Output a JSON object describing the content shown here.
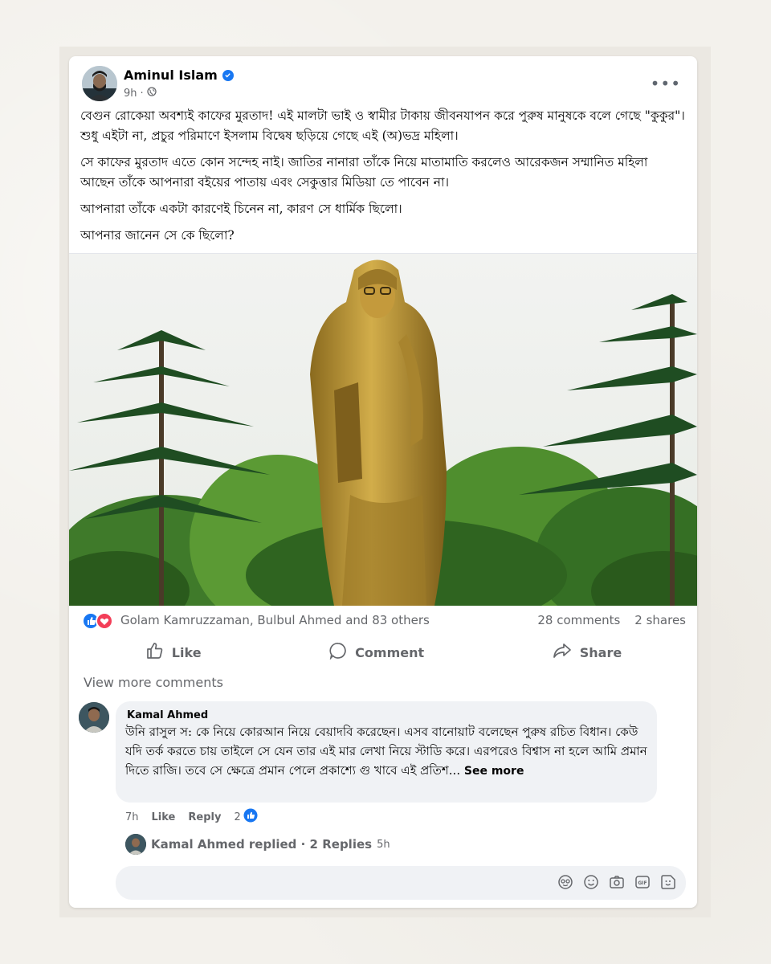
{
  "post": {
    "author": "Aminul Islam",
    "time": "9h",
    "privacy_icon": "globe-icon",
    "verified_icon": "verified-badge-icon",
    "paragraphs": [
      "বেগুন রোকেয়া অবশ্যই কাফের মুরতাদ! এই মালটা ভাই ও স্বামীর টাকায় জীবনযাপন করে পুরুষ মানুষকে বলে গেছে \"কুকুর\"। শুধু এইটা না, প্রচুর পরিমাণে ইসলাম বিদ্বেষ ছড়িয়ে গেছে এই (অ)ভদ্র মহিলা।",
      "সে কাফের মুরতাদ এতে কোন সন্দেহ নাই। জাতির নানারা তাঁকে নিয়ে মাতামাতি করলেও আরেকজন সম্মানিত মহিলা আছেন তাঁকে আপনারা বইয়ের পাতায় এবং সেকুত্তার মিডিয়া তে পাবেন না।",
      "আপনারা তাঁকে একটা কারণেই চিনেন না, কারণ সে ধার্মিক ছিলো।",
      "আপনার জানেন সে কে ছিলো?"
    ]
  },
  "engagement": {
    "reaction_icons": [
      "like-reaction-icon",
      "love-reaction-icon"
    ],
    "reactors": "Golam Kamruzzaman, Bulbul Ahmed and 83 others",
    "comments": "28 comments",
    "shares": "2 shares"
  },
  "actions": {
    "like": "Like",
    "comment": "Comment",
    "share": "Share"
  },
  "comments_section": {
    "view_more": "View more comments",
    "comment": {
      "author": "Kamal Ahmed",
      "text": "উনি রাসুল স: কে নিয়ে কোরআন নিয়ে বেয়াদবি করেছেন। এসব বানোয়াট বলেছেন পুরুষ রচিত বিধান। কেউ যদি তর্ক করতে চায় তাইলে সে যেন তার এই মার লেখা নিয়ে স্টাডি করে। এরপরেও বিশ্বাস না হলে আমি প্রমান দিতে রাজি। তবে সে ক্ষেত্রে প্রমান পেলে প্রকাশ্যে গু খাবে এই প্রতিশ...",
      "see_more": "See more",
      "time": "7h",
      "like": "Like",
      "reply": "Reply",
      "like_count": "2"
    },
    "replies": {
      "text": "Kamal Ahmed replied · 2 Replies",
      "age": "5h"
    },
    "compose": {
      "placeholder": "",
      "icons": [
        "avatar-sticker-icon",
        "emoji-icon",
        "camera-icon",
        "gif-icon",
        "sticker-icon"
      ]
    }
  },
  "colors": {
    "brand_blue": "#1877f2",
    "love_red": "#f33e58",
    "muted_text": "#65676b"
  }
}
